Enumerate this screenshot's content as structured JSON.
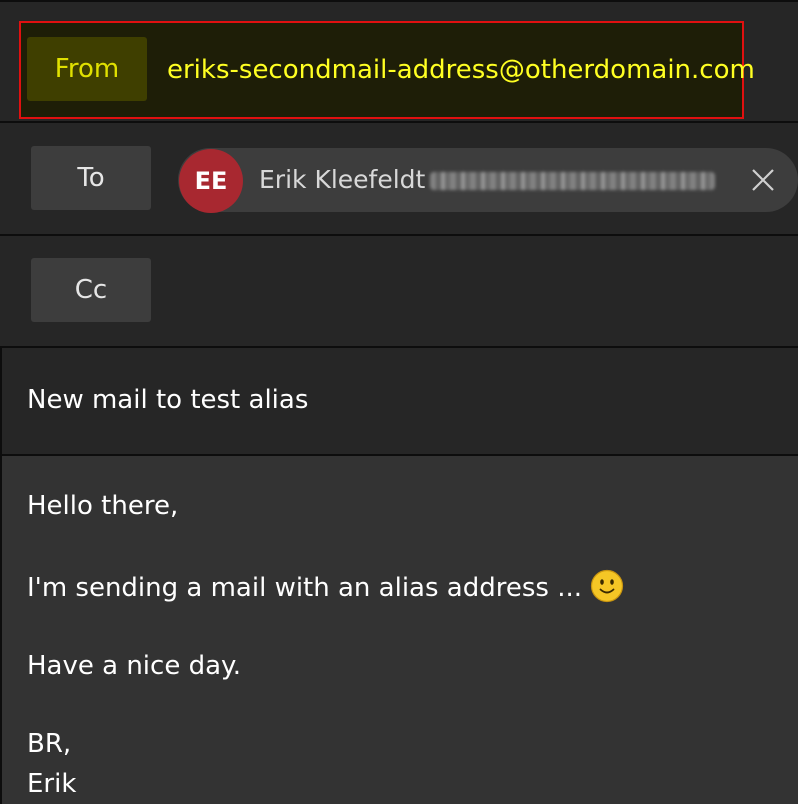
{
  "from": {
    "label": "From",
    "address": "eriks-secondmail-address@otherdomain.com"
  },
  "to": {
    "label": "To",
    "recipient": {
      "initials": "EE",
      "name": "Erik Kleefeldt",
      "email": "••••••••••••••••"
    },
    "remove_icon": "close-icon"
  },
  "cc": {
    "label": "Cc"
  },
  "subject": "New mail to test alias",
  "body": {
    "line1": "Hello there,",
    "line2": "I'm sending a mail with an alias address ...",
    "line3": "Have a nice day.",
    "line4": "BR,",
    "line5": "Erik",
    "emoji": "slightly-smiling-face-icon"
  },
  "colors": {
    "highlight_border": "#e01010",
    "from_text": "#ffff22",
    "avatar_bg": "#a82830"
  }
}
